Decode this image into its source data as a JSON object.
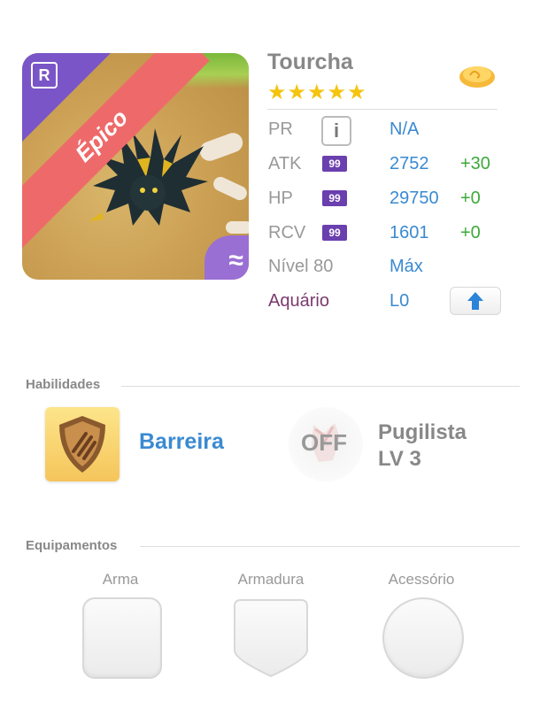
{
  "monster": {
    "name": "Tourcha",
    "stars": "★★★★★",
    "rarity_label": "Épico",
    "rarity_icon": "R",
    "element_icon": "≈"
  },
  "stats": {
    "pr_label": "PR",
    "pr_info_icon": "i",
    "pr_value": "N/A",
    "atk_label": "ATK",
    "atk_badge": "99",
    "atk_value": "2752",
    "atk_bonus": "+30",
    "hp_label": "HP",
    "hp_badge": "99",
    "hp_value": "29750",
    "hp_bonus": "+0",
    "rcv_label": "RCV",
    "rcv_badge": "99",
    "rcv_value": "1601",
    "rcv_bonus": "+0",
    "level_label": "Nível 80",
    "level_value": "Máx",
    "aquarium_label": "Aquário",
    "aquarium_value": "L0"
  },
  "skills": {
    "title": "Habilidades",
    "active_name": "Barreira",
    "leader_status": "OFF",
    "leader_name_line1": "Pugilista",
    "leader_name_line2": "LV 3"
  },
  "equipment": {
    "title": "Equipamentos",
    "weapon_label": "Arma",
    "armor_label": "Armadura",
    "accessory_label": "Acessório"
  },
  "colors": {
    "accent_blue": "#3a8ad1",
    "bonus_green": "#3daa3a",
    "badge_purple": "#6a3fae",
    "rarity_red": "#ee6a6a",
    "star_gold": "#f4c40f"
  }
}
